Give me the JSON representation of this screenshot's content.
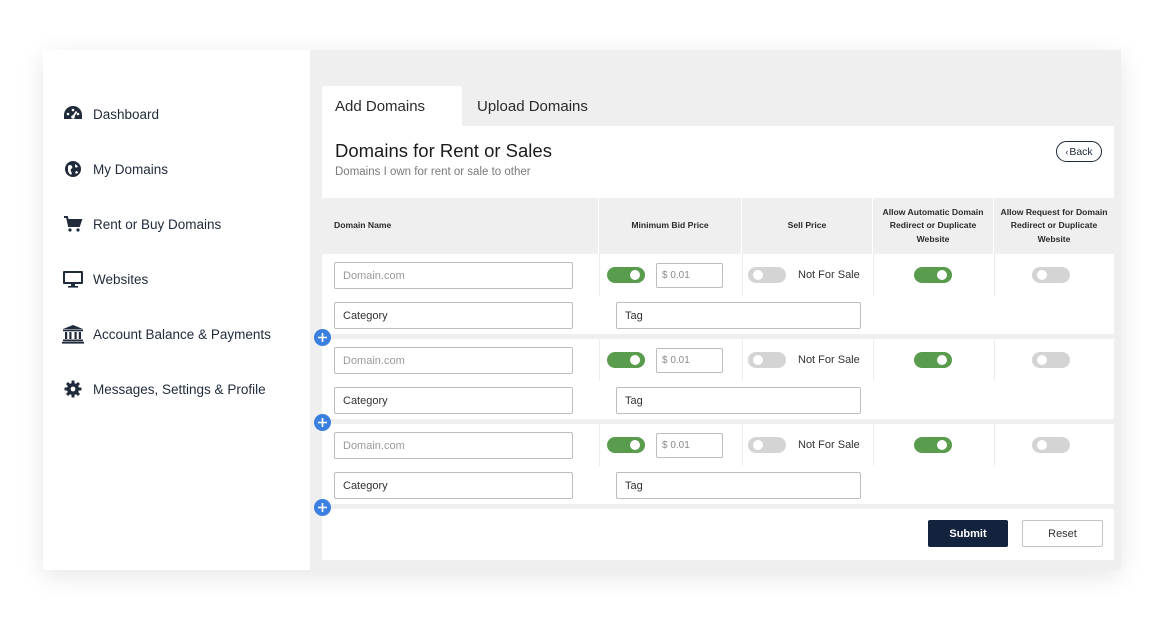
{
  "sidebar": {
    "items": [
      {
        "label": "Dashboard",
        "icon": "dashboard-icon"
      },
      {
        "label": "My Domains",
        "icon": "globe-icon"
      },
      {
        "label": "Rent or Buy Domains",
        "icon": "cart-icon"
      },
      {
        "label": "Websites",
        "icon": "monitor-icon"
      },
      {
        "label": "Account Balance & Payments",
        "icon": "bank-icon"
      },
      {
        "label": "Messages, Settings & Profile",
        "icon": "gear-icon"
      }
    ]
  },
  "tabs": [
    {
      "label": "Add Domains",
      "active": true
    },
    {
      "label": "Upload Domains",
      "active": false
    }
  ],
  "panel": {
    "title": "Domains for Rent or Sales",
    "subtitle": "Domains I own for rent or sale to other",
    "back_label": "Back"
  },
  "table": {
    "headers": [
      "Domain Name",
      "Minimum Bid Price",
      "Sell Price",
      "Allow Automatic Domain Redirect or Duplicate Website",
      "Allow Request for Domain Redirect or Duplicate Website"
    ],
    "rows": [
      {
        "domain_placeholder": "Domain.com",
        "min_bid_enabled": true,
        "price_placeholder": "$ 0.01",
        "sell_enabled": false,
        "sell_label": "Not For Sale",
        "auto_redirect": true,
        "request_redirect": false,
        "category": "Category",
        "tag": "Tag"
      },
      {
        "domain_placeholder": "Domain.com",
        "min_bid_enabled": true,
        "price_placeholder": "$ 0.01",
        "sell_enabled": false,
        "sell_label": "Not For Sale",
        "auto_redirect": true,
        "request_redirect": false,
        "category": "Category",
        "tag": "Tag"
      },
      {
        "domain_placeholder": "Domain.com",
        "min_bid_enabled": true,
        "price_placeholder": "$ 0.01",
        "sell_enabled": false,
        "sell_label": "Not For Sale",
        "auto_redirect": true,
        "request_redirect": false,
        "category": "Category",
        "tag": "Tag"
      }
    ]
  },
  "actions": {
    "submit_label": "Submit",
    "reset_label": "Reset"
  },
  "colors": {
    "toggle_on": "#5a9c4e",
    "toggle_off": "#d4d4d4",
    "add_button": "#3b7fe0",
    "submit": "#14233d"
  }
}
